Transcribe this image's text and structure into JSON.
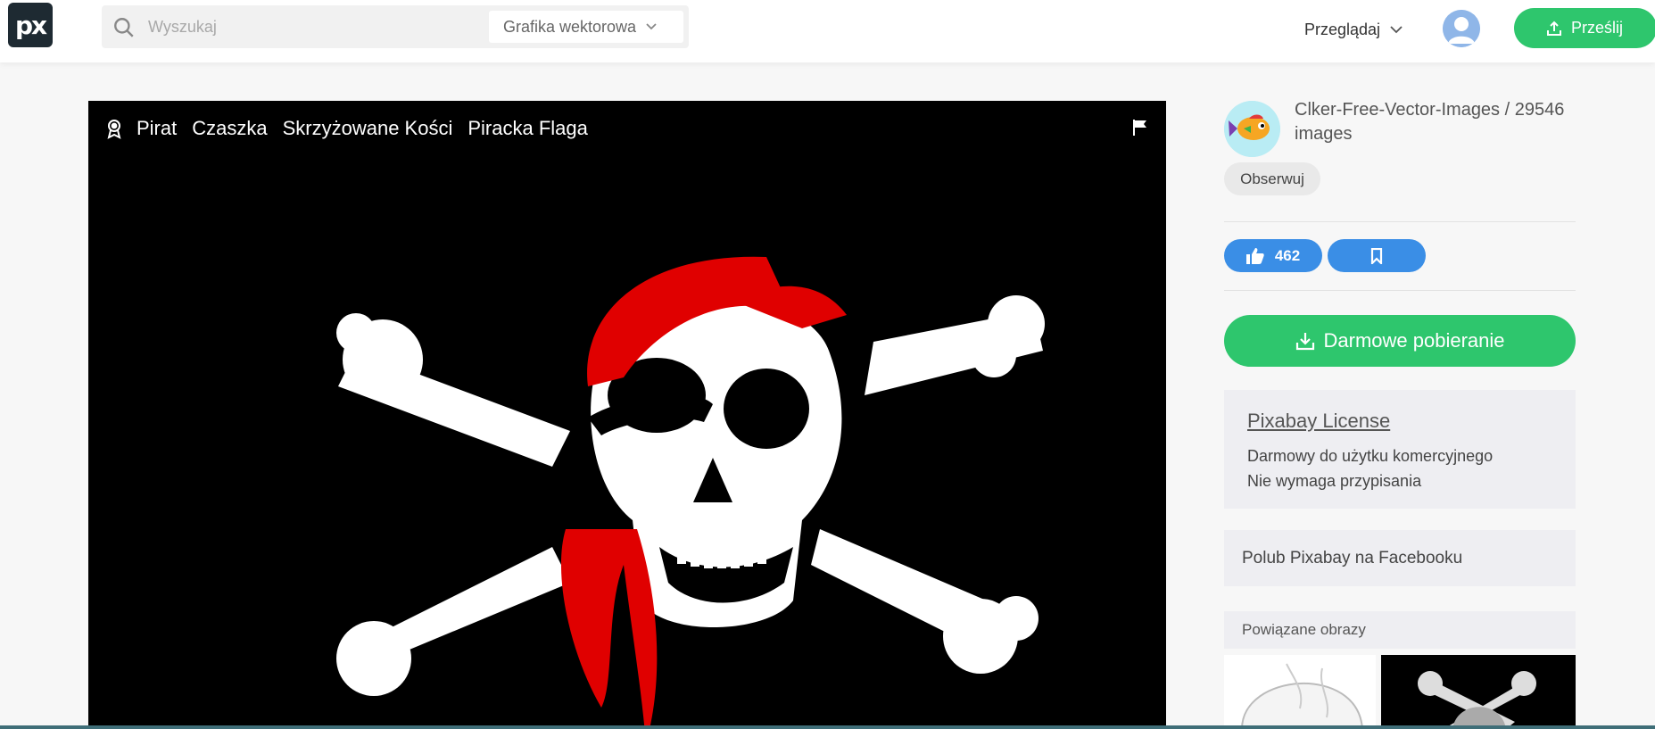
{
  "header": {
    "logo_text": "px",
    "search_placeholder": "Wyszukaj",
    "media_type": "Grafika wektorowa",
    "browse_label": "Przeglądaj",
    "upload_label": "Prześlij"
  },
  "image": {
    "tags": [
      "Pirat",
      "Czaszka",
      "Skrzyżowane Kości",
      "Piracka Flaga"
    ]
  },
  "sidebar": {
    "author": "Clker-Free-Vector-Images / 29546 images",
    "follow_label": "Obserwuj",
    "likes": "462",
    "download_label": "Darmowe pobieranie",
    "license": {
      "title": "Pixabay License",
      "line1": "Darmowy do użytku komercyjnego",
      "line2": "Nie wymaga przypisania"
    },
    "facebook_label": "Polub Pixabay na Facebooku",
    "related_label": "Powiązane obrazy"
  },
  "colors": {
    "accent_green": "#2ec66d",
    "accent_blue": "#3a8ee6",
    "logo_bg": "#1e2a32",
    "bandana_red": "#e00000"
  },
  "icons": [
    "search-icon",
    "chevron-down-icon",
    "user-avatar-icon",
    "upload-icon",
    "award-icon",
    "flag-icon",
    "thumbs-up-icon",
    "bookmark-icon",
    "download-icon"
  ]
}
